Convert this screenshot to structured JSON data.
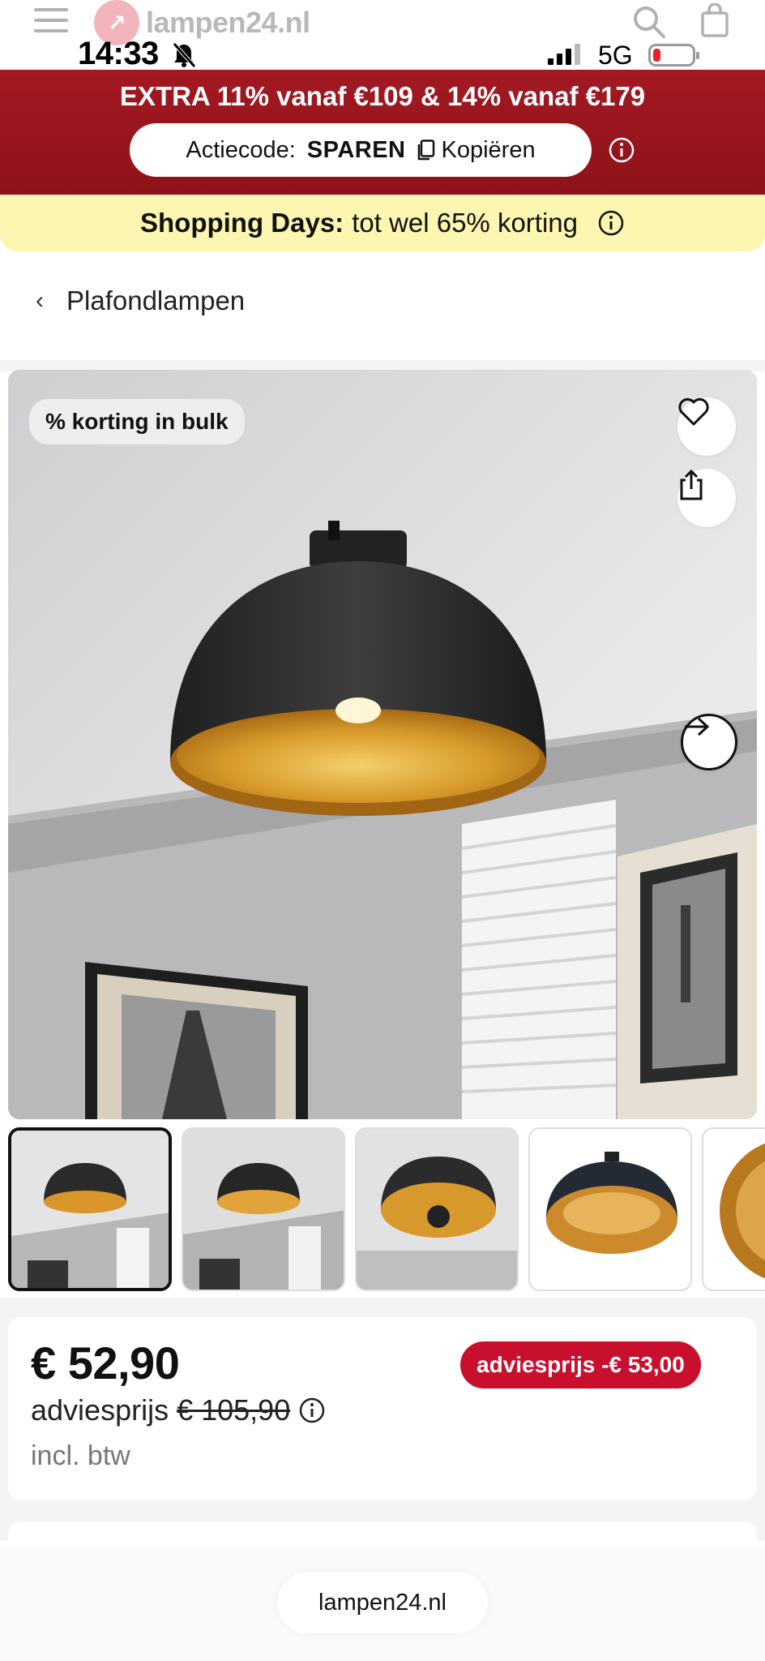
{
  "status_bar": {
    "time": "14:33",
    "network": "5G",
    "battery_fraction": 0.12
  },
  "header": {
    "logo_text": "lampen24.nl",
    "logo_mark": "↗",
    "icons": [
      "menu-icon",
      "search-icon",
      "shopping-bag-icon"
    ]
  },
  "promo": {
    "title": "EXTRA 11% vanaf €109 & 14% vanaf €179",
    "code_label": "Actiecode:",
    "code_value": "SPAREN",
    "copy_label": "Kopiëren",
    "background_color": "#9b161e"
  },
  "shopping_days": {
    "bold_label": "Shopping Days:",
    "text": "tot wel 65% korting",
    "background_color": "#fcf6b0"
  },
  "breadcrumb": {
    "label": "Plafondlampen"
  },
  "gallery": {
    "badge": "% korting in bulk",
    "thumbnail_count_visible": 5,
    "active_thumbnail": 1
  },
  "price": {
    "current": "€ 52,90",
    "badge": "adviesprijs -€ 53,00",
    "badge_color": "#c8102e",
    "advice_label": "adviesprijs",
    "advice_old": "€ 105,90",
    "vat_note": "incl. btw"
  },
  "browser": {
    "url": "lampen24.nl"
  }
}
